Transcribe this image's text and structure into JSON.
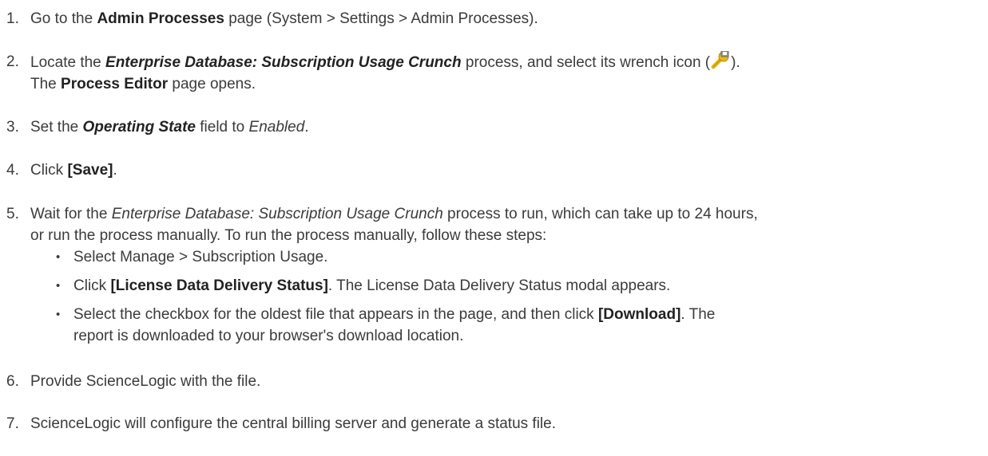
{
  "steps": [
    {
      "num": "1.",
      "parts": [
        "Go to the ",
        "Admin Processes",
        " page (System > Settings > Admin Processes)."
      ]
    },
    {
      "num": "2.",
      "parts": [
        "Locate the ",
        "Enterprise Database: Subscription Usage Crunch",
        " process, and select its wrench icon (",
        ").",
        "The ",
        "Process Editor",
        " page opens."
      ]
    },
    {
      "num": "3.",
      "parts": [
        "Set the ",
        "Operating State",
        " field to ",
        "Enabled",
        "."
      ]
    },
    {
      "num": "4.",
      "parts": [
        "Click ",
        "[Save]",
        "."
      ]
    },
    {
      "num": "5.",
      "parts": [
        "Wait for the ",
        "Enterprise Database: Subscription Usage Crunch",
        " process to run, which can take up to 24 hours,",
        "or run the process manually. To run the process manually, follow these steps:"
      ]
    },
    {
      "num": "6.",
      "parts": [
        "Provide ScienceLogic with the file."
      ]
    },
    {
      "num": "7.",
      "parts": [
        "ScienceLogic will configure the central billing server and generate a status file."
      ]
    }
  ],
  "substeps": [
    {
      "bullet": "•",
      "parts": [
        "Select Manage > Subscription Usage."
      ]
    },
    {
      "bullet": "•",
      "parts": [
        "Click ",
        "[License Data Delivery Status]",
        ". The License Data Delivery Status modal appears."
      ]
    },
    {
      "bullet": "•",
      "parts": [
        "Select the checkbox for the oldest file that appears in the page, and then click ",
        "[Download]",
        ". The",
        "report is downloaded to your browser's download location."
      ]
    }
  ],
  "icons": {
    "wrench": "wrench-icon"
  },
  "colors": {
    "text": "#3b3b3b",
    "icon_yellow": "#e8b818",
    "icon_gray": "#8a8a8a"
  }
}
